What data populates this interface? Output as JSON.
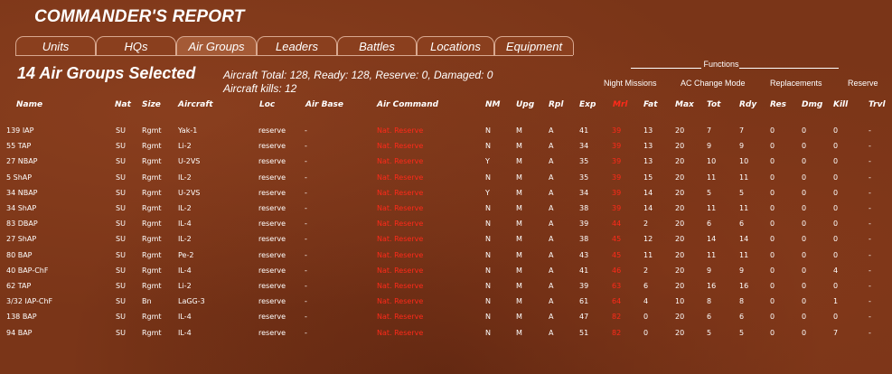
{
  "window_title": "COMMANDER'S REPORT",
  "tabs": [
    "Units",
    "HQs",
    "Air Groups",
    "Leaders",
    "Battles",
    "Locations",
    "Equipment"
  ],
  "active_tab": "Air Groups",
  "selection_title": "14 Air Groups Selected",
  "summary_line1": "Aircraft Total: 128, Ready: 128, Reserve: 0, Damaged: 0",
  "summary_line2": "Aircraft kills: 12",
  "functions": {
    "heading": "Functions",
    "buttons": [
      "Night Missions",
      "AC Change Mode",
      "Replacements",
      "Reserve"
    ]
  },
  "columns": [
    "Name",
    "Nat",
    "Size",
    "Aircraft",
    "Loc",
    "Air Base",
    "Air Command",
    "NM",
    "Upg",
    "Rpl",
    "Exp",
    "Mrl",
    "Fat",
    "Max",
    "Tot",
    "Rdy",
    "Res",
    "Dmg",
    "Kill",
    "Trvl"
  ],
  "sort_column": "Mrl",
  "colors": {
    "highlight_red": "#ff2a1a",
    "background": "#7a3518"
  },
  "rows": [
    [
      "139 IAP",
      "SU",
      "Rgmt",
      "Yak-1",
      "reserve",
      "-",
      "Nat. Reserve",
      "N",
      "M",
      "A",
      "41",
      "39",
      "13",
      "20",
      "7",
      "7",
      "0",
      "0",
      "0",
      "-"
    ],
    [
      "55 TAP",
      "SU",
      "Rgmt",
      "Li-2",
      "reserve",
      "-",
      "Nat. Reserve",
      "N",
      "M",
      "A",
      "34",
      "39",
      "13",
      "20",
      "9",
      "9",
      "0",
      "0",
      "0",
      "-"
    ],
    [
      "27 NBAP",
      "SU",
      "Rgmt",
      "U-2VS",
      "reserve",
      "-",
      "Nat. Reserve",
      "Y",
      "M",
      "A",
      "35",
      "39",
      "13",
      "20",
      "10",
      "10",
      "0",
      "0",
      "0",
      "-"
    ],
    [
      "5 ShAP",
      "SU",
      "Rgmt",
      "IL-2",
      "reserve",
      "-",
      "Nat. Reserve",
      "N",
      "M",
      "A",
      "35",
      "39",
      "15",
      "20",
      "11",
      "11",
      "0",
      "0",
      "0",
      "-"
    ],
    [
      "34 NBAP",
      "SU",
      "Rgmt",
      "U-2VS",
      "reserve",
      "-",
      "Nat. Reserve",
      "Y",
      "M",
      "A",
      "34",
      "39",
      "14",
      "20",
      "5",
      "5",
      "0",
      "0",
      "0",
      "-"
    ],
    [
      "34 ShAP",
      "SU",
      "Rgmt",
      "IL-2",
      "reserve",
      "-",
      "Nat. Reserve",
      "N",
      "M",
      "A",
      "38",
      "39",
      "14",
      "20",
      "11",
      "11",
      "0",
      "0",
      "0",
      "-"
    ],
    [
      "83 DBAP",
      "SU",
      "Rgmt",
      "IL-4",
      "reserve",
      "-",
      "Nat. Reserve",
      "N",
      "M",
      "A",
      "39",
      "44",
      "2",
      "20",
      "6",
      "6",
      "0",
      "0",
      "0",
      "-"
    ],
    [
      "27 ShAP",
      "SU",
      "Rgmt",
      "IL-2",
      "reserve",
      "-",
      "Nat. Reserve",
      "N",
      "M",
      "A",
      "38",
      "45",
      "12",
      "20",
      "14",
      "14",
      "0",
      "0",
      "0",
      "-"
    ],
    [
      "80 BAP",
      "SU",
      "Rgmt",
      "Pe-2",
      "reserve",
      "-",
      "Nat. Reserve",
      "N",
      "M",
      "A",
      "43",
      "45",
      "11",
      "20",
      "11",
      "11",
      "0",
      "0",
      "0",
      "-"
    ],
    [
      "40 BAP-ChF",
      "SU",
      "Rgmt",
      "IL-4",
      "reserve",
      "-",
      "Nat. Reserve",
      "N",
      "M",
      "A",
      "41",
      "46",
      "2",
      "20",
      "9",
      "9",
      "0",
      "0",
      "4",
      "-"
    ],
    [
      "62 TAP",
      "SU",
      "Rgmt",
      "Li-2",
      "reserve",
      "-",
      "Nat. Reserve",
      "N",
      "M",
      "A",
      "39",
      "63",
      "6",
      "20",
      "16",
      "16",
      "0",
      "0",
      "0",
      "-"
    ],
    [
      "3/32 IAP-ChF",
      "SU",
      "Bn",
      "LaGG-3",
      "reserve",
      "-",
      "Nat. Reserve",
      "N",
      "M",
      "A",
      "61",
      "64",
      "4",
      "10",
      "8",
      "8",
      "0",
      "0",
      "1",
      "-"
    ],
    [
      "138 BAP",
      "SU",
      "Rgmt",
      "IL-4",
      "reserve",
      "-",
      "Nat. Reserve",
      "N",
      "M",
      "A",
      "47",
      "82",
      "0",
      "20",
      "6",
      "6",
      "0",
      "0",
      "0",
      "-"
    ],
    [
      "94 BAP",
      "SU",
      "Rgmt",
      "IL-4",
      "reserve",
      "-",
      "Nat. Reserve",
      "N",
      "M",
      "A",
      "51",
      "82",
      "0",
      "20",
      "5",
      "5",
      "0",
      "0",
      "7",
      "-"
    ]
  ]
}
